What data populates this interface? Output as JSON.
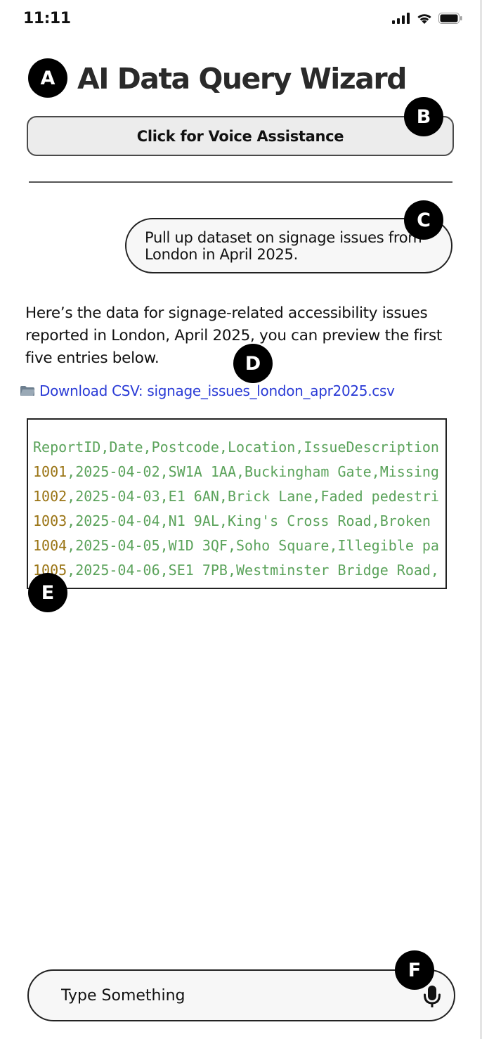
{
  "status_bar": {
    "time": "11:11"
  },
  "title": "AI Data Query Wizard",
  "voice_button": {
    "label": "Click for Voice Assistance"
  },
  "chat": {
    "user_message": "Pull up dataset on signage issues from London in April 2025.",
    "assistant_message": "Here’s the data for signage-related accessibility issues reported in London, April 2025, you can preview the first five entries below.",
    "download": {
      "label": "Download CSV: signage_issues_london_apr2025.csv",
      "icon": "folder-icon"
    }
  },
  "csv_preview": {
    "header": "ReportID,Date,Postcode,Location,IssueDescription",
    "rows": [
      {
        "id": "1001",
        "rest": ",2025-04-02,SW1A 1AA,Buckingham Gate,Missing"
      },
      {
        "id": "1002",
        "rest": ",2025-04-03,E1 6AN,Brick Lane,Faded pedestri"
      },
      {
        "id": "1003",
        "rest": ",2025-04-04,N1 9AL,King's Cross Road,Broken"
      },
      {
        "id": "1004",
        "rest": ",2025-04-05,W1D 3QF,Soho Square,Illegible pa"
      },
      {
        "id": "1005",
        "rest": ",2025-04-06,SE1 7PB,Westminster Bridge Road,"
      }
    ]
  },
  "input": {
    "placeholder": "Type Something",
    "value": ""
  },
  "annotations": [
    "A",
    "B",
    "C",
    "D",
    "E",
    "F"
  ],
  "colors": {
    "link": "#2a3bd6",
    "csv_text": "#5ba35b",
    "csv_id": "#9a7414",
    "badge": "#000000"
  }
}
